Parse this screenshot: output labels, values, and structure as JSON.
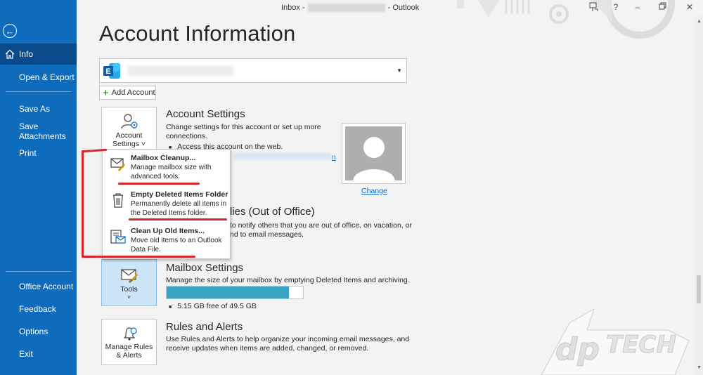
{
  "window": {
    "title_prefix": "Inbox -",
    "title_suffix": "- Outlook"
  },
  "sidebar": {
    "items": [
      {
        "label": "Info"
      },
      {
        "label": "Open & Export"
      },
      {
        "label": "Save As"
      },
      {
        "label": "Save Attachments"
      },
      {
        "label": "Print"
      },
      {
        "label": "Office Account"
      },
      {
        "label": "Feedback"
      },
      {
        "label": "Options"
      },
      {
        "label": "Exit"
      }
    ]
  },
  "main": {
    "page_title": "Account Information",
    "add_account_label": "Add Account",
    "account_settings": {
      "tile_label_1": "Account",
      "tile_label_2": "Settings ˅",
      "title": "Account Settings",
      "desc": "Change settings for this account or set up more connections.",
      "bullet": "Access this account on the web.",
      "link_tail": "n",
      "change_link": "Change"
    },
    "auto_replies": {
      "title_visible": "lies (Out of Office)",
      "desc_line1": "to notify others that you are out of office, on vacation, or",
      "desc_line2": "nd to email messages."
    },
    "mailbox": {
      "tile_label": "Tools",
      "title": "Mailbox Settings",
      "desc": "Manage the size of your mailbox by emptying Deleted Items and archiving.",
      "usage_text": "5.15 GB free of 49.5 GB",
      "usage_fraction": 0.896
    },
    "rules": {
      "tile_label_1": "Manage Rules",
      "tile_label_2": "& Alerts",
      "title": "Rules and Alerts",
      "desc": "Use Rules and Alerts to help organize your incoming email messages, and receive updates when items are added, changed, or removed."
    }
  },
  "tools_menu": {
    "items": [
      {
        "title": "Mailbox Cleanup...",
        "desc": "Manage mailbox size with advanced tools.",
        "icon": "mailbox-cleanup-icon"
      },
      {
        "title": "Empty Deleted Items Folder",
        "desc": "Permanently delete all items in the Deleted Items folder.",
        "icon": "trash-icon"
      },
      {
        "title": "Clean Up Old Items...",
        "desc": "Move old items to an Outlook Data File.",
        "icon": "archive-icon"
      }
    ]
  },
  "colors": {
    "sidebar": "#0f6cbd",
    "sidebar_active": "#094b8a",
    "annotation": "#d9262a",
    "usage_fill": "#38a4c1"
  }
}
